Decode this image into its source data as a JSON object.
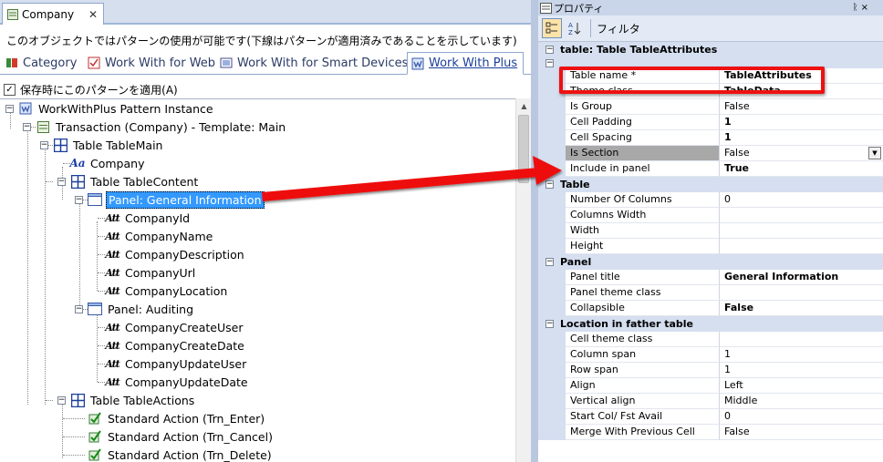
{
  "doc_tab": {
    "title": "Company",
    "close": "✕"
  },
  "description": "このオブジェクトではパターンの使用が可能です(下線はパターンが適用済みであることを示しています)",
  "pattern_tabs": [
    {
      "label": "Category"
    },
    {
      "label": "Work With for Web"
    },
    {
      "label": "Work With for Smart Devices"
    },
    {
      "label": "Work With Plus"
    }
  ],
  "apply_checkbox": {
    "label": "保存時にこのパターンを適用(A)",
    "checked": true
  },
  "tree": {
    "root": "WorkWithPlus Pattern Instance",
    "transaction": "Transaction (Company) - Template: Main",
    "table_main": "Table TableMain",
    "company": "Company",
    "table_content": "Table TableContent",
    "panel_general": "Panel: General Information",
    "general_items": [
      "CompanyId",
      "CompanyName",
      "CompanyDescription",
      "CompanyUrl",
      "CompanyLocation"
    ],
    "panel_auditing": "Panel: Auditing",
    "auditing_items": [
      "CompanyCreateUser",
      "CompanyCreateDate",
      "CompanyUpdateUser",
      "CompanyUpdateDate"
    ],
    "table_actions": "Table TableActions",
    "actions": [
      "Standard Action (Trn_Enter)",
      "Standard Action (Trn_Cancel)",
      "Standard Action (Trn_Delete)"
    ]
  },
  "properties": {
    "title": "プロパティ",
    "pin": "ᚱ ×",
    "toolbar": {
      "filter_label": "フィルタ"
    },
    "header": "table: Table TableAttributes",
    "general_rows": [
      {
        "name": "Table name *",
        "value": "TableAttributes",
        "bold": true
      },
      {
        "name": "Theme class",
        "value": "TableData",
        "bold": true
      },
      {
        "name": "Is Group",
        "value": "False",
        "bold": false
      },
      {
        "name": "Cell Padding",
        "value": "1",
        "bold": true
      },
      {
        "name": "Cell Spacing",
        "value": "1",
        "bold": true
      },
      {
        "name": "Is Section",
        "value": "False",
        "bold": false
      },
      {
        "name": "Include in panel",
        "value": "True",
        "bold": true
      }
    ],
    "table_category": "Table",
    "table_rows": [
      {
        "name": "Number Of Columns",
        "value": "0",
        "bold": false
      },
      {
        "name": "Columns Width",
        "value": "",
        "bold": false
      },
      {
        "name": "Width",
        "value": "",
        "bold": false
      },
      {
        "name": "Height",
        "value": "",
        "bold": false
      }
    ],
    "panel_category": "Panel",
    "panel_rows": [
      {
        "name": "Panel title",
        "value": "General Information",
        "bold": true
      },
      {
        "name": "Panel theme class",
        "value": "",
        "bold": false
      },
      {
        "name": "Collapsible",
        "value": "False",
        "bold": true
      }
    ],
    "location_category": "Location in father table",
    "location_rows": [
      {
        "name": "Cell theme class",
        "value": "",
        "bold": false
      },
      {
        "name": "Column span",
        "value": "1",
        "bold": false
      },
      {
        "name": "Row span",
        "value": "1",
        "bold": false
      },
      {
        "name": "Align",
        "value": "Left",
        "bold": false
      },
      {
        "name": "Vertical align",
        "value": "Middle",
        "bold": false
      },
      {
        "name": "Start Col/ Fst Avail",
        "value": "0",
        "bold": false
      },
      {
        "name": "Merge With Previous Cell",
        "value": "False",
        "bold": false
      }
    ]
  },
  "colors": {
    "accent": "#3399ff",
    "annotation": "#ee1111",
    "category_bg": "#d5dff0"
  }
}
